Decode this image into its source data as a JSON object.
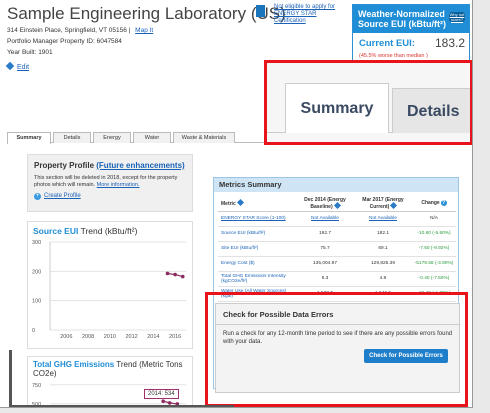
{
  "property": {
    "name": "Sample Engineering Laboratory (US)",
    "address": "314 Einstein Place, Springfield, VT 05156",
    "map_link": "Map It",
    "portfolio_id": "Portfolio Manager Property ID: 6047584",
    "year_built": "Year Built: 1901",
    "edit": "Edit"
  },
  "energy_star": {
    "icon": "energy-star-logo",
    "label": "Not eligible to apply for ENERGY STAR Certification"
  },
  "eui_panel": {
    "title": "Weather-Normalized Source EUI (kBtu/ft²)",
    "help": "Why not score?",
    "current_label": "Current EUI:",
    "current_value": "183.2",
    "note": "(45.5% worse than median )"
  },
  "tabs": [
    "Summary",
    "Details",
    "Energy",
    "Water",
    "Waste & Materials"
  ],
  "zoom_tabs": [
    "Summary",
    "Details"
  ],
  "profile": {
    "title": "Property Profile",
    "future_link": "(Future enhancements)",
    "desc": "This section will be deleted in 2018, except for the property photos which will remain.",
    "more_link": "More information.",
    "create_link": "Create Profile"
  },
  "eui_chart": {
    "title_highlight": "Source EUI",
    "title_rest": " Trend (kBtu/ft²)",
    "chart_data": {
      "type": "line",
      "x": [
        2015.3,
        2016.0,
        2016.7
      ],
      "values": [
        192.7,
        189,
        182.1
      ],
      "xlim": [
        2004.5,
        2017
      ],
      "ylim": [
        0,
        300
      ],
      "yticks": [
        0,
        100,
        200,
        300
      ],
      "xticks": [
        "2006",
        "2008",
        "2010",
        "2012",
        "2014",
        "2016"
      ]
    }
  },
  "ghg_chart": {
    "title_highlight": "Total GHG Emissions",
    "title_rest": " Trend (Metric Tons CO2e)",
    "tooltip": "2014: 534",
    "chart_data": {
      "type": "line",
      "x": [
        2014.9,
        2015.5,
        2016.2
      ],
      "values": [
        534,
        512,
        498
      ],
      "ylim": [
        300,
        800
      ],
      "yticks": [
        500,
        750
      ]
    }
  },
  "metrics": {
    "title": "Metrics Summary",
    "headers": {
      "metric": "Metric",
      "baseline": "Dec 2014 (Energy Baseline)",
      "current": "Mar 2017 (Energy Current)",
      "change": "Change"
    },
    "rows": [
      {
        "metric": "ENERGY STAR Score (1-100)",
        "baseline": "Not Available",
        "current": "Not Available",
        "change": "N/A"
      },
      {
        "metric": "Source EUI (kBtu/ft²)",
        "baseline": "192.7",
        "current": "182.1",
        "change": "-10.60 (-5.50%)"
      },
      {
        "metric": "Site EUI (kBtu/ft²)",
        "baseline": "75.7",
        "current": "69.1",
        "change": "-7.60 (-9.92%)"
      },
      {
        "metric": "Energy Cost ($)",
        "baseline": "135,004.97",
        "current": "129,825.39",
        "change": "-5179.58 (-3.90%)"
      },
      {
        "metric": "Total GHG Emissions Intensity (kgCO2e/ft²)",
        "baseline": "5.3",
        "current": "4.9",
        "change": "-0.40 (-7.50%)"
      },
      {
        "metric": "Water Use (All Water Sources) (kgal)",
        "baseline": "1,572.9",
        "current": "1,546.5",
        "change": "-26.40 (-1.70%)"
      },
      {
        "metric": "Total Waste (Disposed and Diverted) (Tons)",
        "baseline": "211.24",
        "current": "522.05",
        "change": "310.81 (147.10%)"
      }
    ]
  },
  "errors_panel": {
    "title": "Check for Possible Data Errors",
    "text": "Run a check for any 12-month time period to see if there are any possible errors found with your data.",
    "button": "Check for Possible Errors"
  }
}
